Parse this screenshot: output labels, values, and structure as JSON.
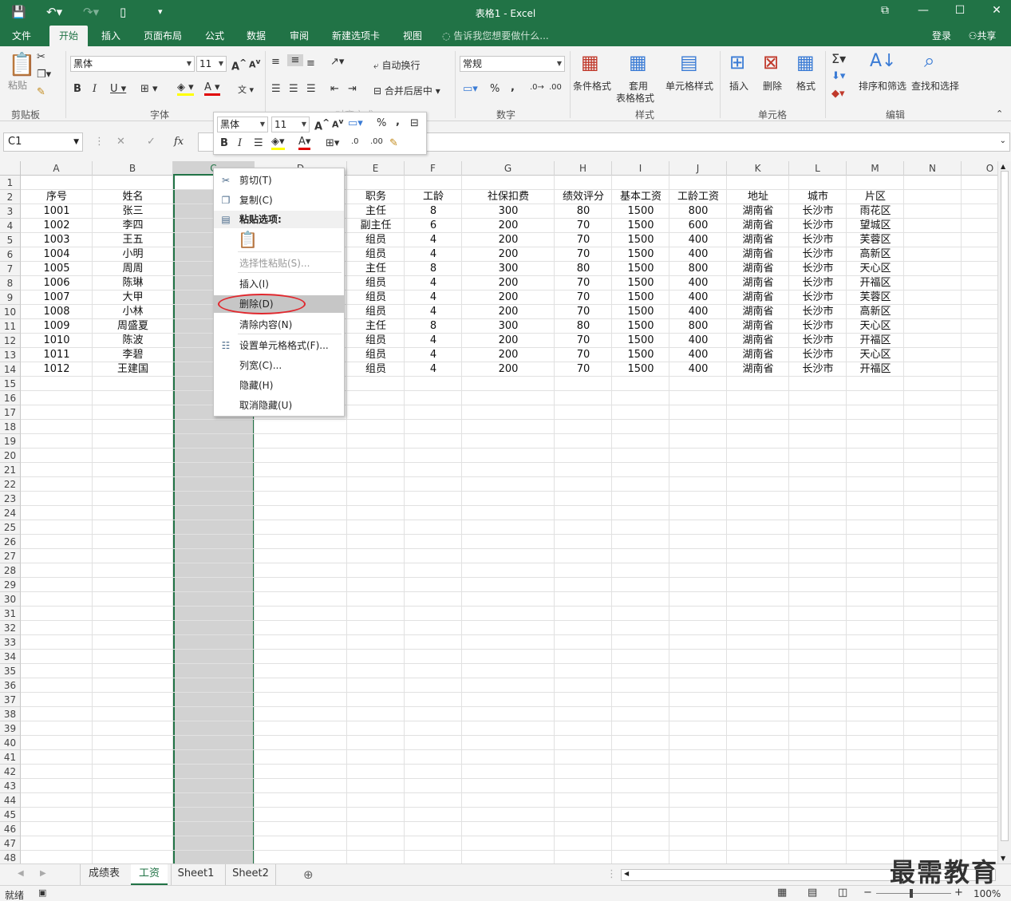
{
  "window": {
    "title": "表格1 - Excel",
    "accent": "#217346"
  },
  "ribbon_tabs": [
    "文件",
    "开始",
    "插入",
    "页面布局",
    "公式",
    "数据",
    "审阅",
    "新建选项卡",
    "视图"
  ],
  "tell_me": "告诉我您想要做什么...",
  "account": {
    "login": "登录",
    "share": "共享"
  },
  "clipboard": {
    "paste": "粘贴",
    "group": "剪贴板"
  },
  "font": {
    "name": "黑体",
    "size": "11",
    "group": "字体"
  },
  "align": {
    "wrap": "自动换行",
    "merge": "合并后居中",
    "group": "对齐方式"
  },
  "number": {
    "format": "常规",
    "group": "数字",
    "percent": "%",
    "comma": ","
  },
  "styles": {
    "cond": "条件格式",
    "table1": "套用",
    "table2": "表格格式",
    "cell": "单元格样式",
    "group": "样式"
  },
  "cells": {
    "insert": "插入",
    "delete": "删除",
    "format": "格式",
    "group": "单元格"
  },
  "editing": {
    "sort": "排序和筛选",
    "find": "查找和选择",
    "group": "编辑"
  },
  "formula_bar": {
    "name_box": "C1",
    "fx": "fx"
  },
  "columns": [
    "A",
    "B",
    "C",
    "D",
    "E",
    "F",
    "G",
    "H",
    "I",
    "J",
    "K",
    "L",
    "M",
    "N",
    "O"
  ],
  "header_row": [
    "序号",
    "姓名",
    "",
    "",
    "职务",
    "工龄",
    "社保扣费",
    "绩效评分",
    "基本工资",
    "工龄工资",
    "地址",
    "城市",
    "片区"
  ],
  "rows": [
    [
      "1001",
      "张三",
      "",
      "",
      "主任",
      "8",
      "300",
      "80",
      "1500",
      "800",
      "湖南省",
      "长沙市",
      "雨花区"
    ],
    [
      "1002",
      "李四",
      "",
      "",
      "副主任",
      "6",
      "200",
      "70",
      "1500",
      "600",
      "湖南省",
      "长沙市",
      "望城区"
    ],
    [
      "1003",
      "王五",
      "",
      "",
      "组员",
      "4",
      "200",
      "70",
      "1500",
      "400",
      "湖南省",
      "长沙市",
      "芙蓉区"
    ],
    [
      "1004",
      "小明",
      "",
      "",
      "组员",
      "4",
      "200",
      "70",
      "1500",
      "400",
      "湖南省",
      "长沙市",
      "高新区"
    ],
    [
      "1005",
      "周周",
      "",
      "",
      "主任",
      "8",
      "300",
      "80",
      "1500",
      "800",
      "湖南省",
      "长沙市",
      "天心区"
    ],
    [
      "1006",
      "陈琳",
      "",
      "",
      "组员",
      "4",
      "200",
      "70",
      "1500",
      "400",
      "湖南省",
      "长沙市",
      "开福区"
    ],
    [
      "1007",
      "大甲",
      "",
      "",
      "组员",
      "4",
      "200",
      "70",
      "1500",
      "400",
      "湖南省",
      "长沙市",
      "芙蓉区"
    ],
    [
      "1008",
      "小林",
      "",
      "",
      "组员",
      "4",
      "200",
      "70",
      "1500",
      "400",
      "湖南省",
      "长沙市",
      "高新区"
    ],
    [
      "1009",
      "周盛夏",
      "",
      "",
      "主任",
      "8",
      "300",
      "80",
      "1500",
      "800",
      "湖南省",
      "长沙市",
      "天心区"
    ],
    [
      "1010",
      "陈波",
      "",
      "",
      "组员",
      "4",
      "200",
      "70",
      "1500",
      "400",
      "湖南省",
      "长沙市",
      "开福区"
    ],
    [
      "1011",
      "李碧",
      "",
      "",
      "组员",
      "4",
      "200",
      "70",
      "1500",
      "400",
      "湖南省",
      "长沙市",
      "天心区"
    ],
    [
      "1012",
      "王建国",
      "",
      "",
      "组员",
      "4",
      "200",
      "70",
      "1500",
      "400",
      "湖南省",
      "长沙市",
      "开福区"
    ]
  ],
  "row_count": 48,
  "mini_toolbar": {
    "font": "黑体",
    "size": "11"
  },
  "context_menu": [
    {
      "label": "剪切(T)",
      "icon": "scissors-icon",
      "glyph": "✂",
      "state": "normal"
    },
    {
      "label": "复制(C)",
      "icon": "copy-icon",
      "glyph": "❐",
      "state": "normal"
    },
    {
      "label": "粘贴选项:",
      "icon": "paste-icon",
      "glyph": "▤",
      "state": "header"
    },
    {
      "label": "",
      "icon": "paste-option-icon",
      "glyph": "",
      "state": "pastebox"
    },
    {
      "label": "选择性粘贴(S)...",
      "icon": "",
      "glyph": "",
      "state": "disabled"
    },
    {
      "label": "插入(I)",
      "icon": "",
      "glyph": "",
      "state": "normal"
    },
    {
      "label": "删除(D)",
      "icon": "",
      "glyph": "",
      "state": "highlight"
    },
    {
      "label": "清除内容(N)",
      "icon": "",
      "glyph": "",
      "state": "normal"
    },
    {
      "label": "设置单元格格式(F)...",
      "icon": "format-cells-icon",
      "glyph": "☷",
      "state": "normal"
    },
    {
      "label": "列宽(C)...",
      "icon": "",
      "glyph": "",
      "state": "normal"
    },
    {
      "label": "隐藏(H)",
      "icon": "",
      "glyph": "",
      "state": "normal"
    },
    {
      "label": "取消隐藏(U)",
      "icon": "",
      "glyph": "",
      "state": "normal"
    }
  ],
  "sheets": [
    "成绩表",
    "工资",
    "Sheet1",
    "Sheet2"
  ],
  "active_sheet": "工资",
  "status": {
    "ready": "就绪",
    "zoom": "100%"
  },
  "watermark": "最需教育"
}
